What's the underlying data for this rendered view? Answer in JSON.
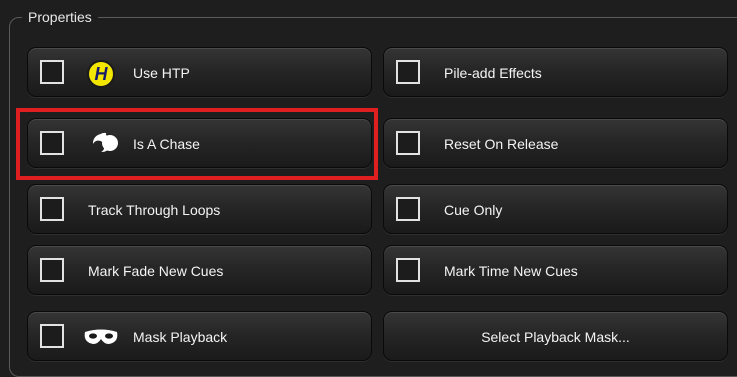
{
  "group": {
    "title": "Properties"
  },
  "buttons": {
    "use_htp": "Use HTP",
    "pile_add_effects": "Pile-add Effects",
    "is_a_chase": "Is A Chase",
    "reset_on_release": "Reset On Release",
    "track_through_loops": "Track Through Loops",
    "cue_only": "Cue Only",
    "mark_fade_new_cues": "Mark Fade New Cues",
    "mark_time_new_cues": "Mark Time New Cues",
    "mask_playback": "Mask Playback",
    "select_playback_mask": "Select Playback Mask..."
  },
  "icons": {
    "htp": "htp-icon",
    "chase": "chase-icon",
    "mask": "mask-icon"
  },
  "colors": {
    "background": "#1e1e1e",
    "htp_badge": "#f2e600",
    "highlight": "#e02020",
    "text": "#f4f4f4"
  }
}
